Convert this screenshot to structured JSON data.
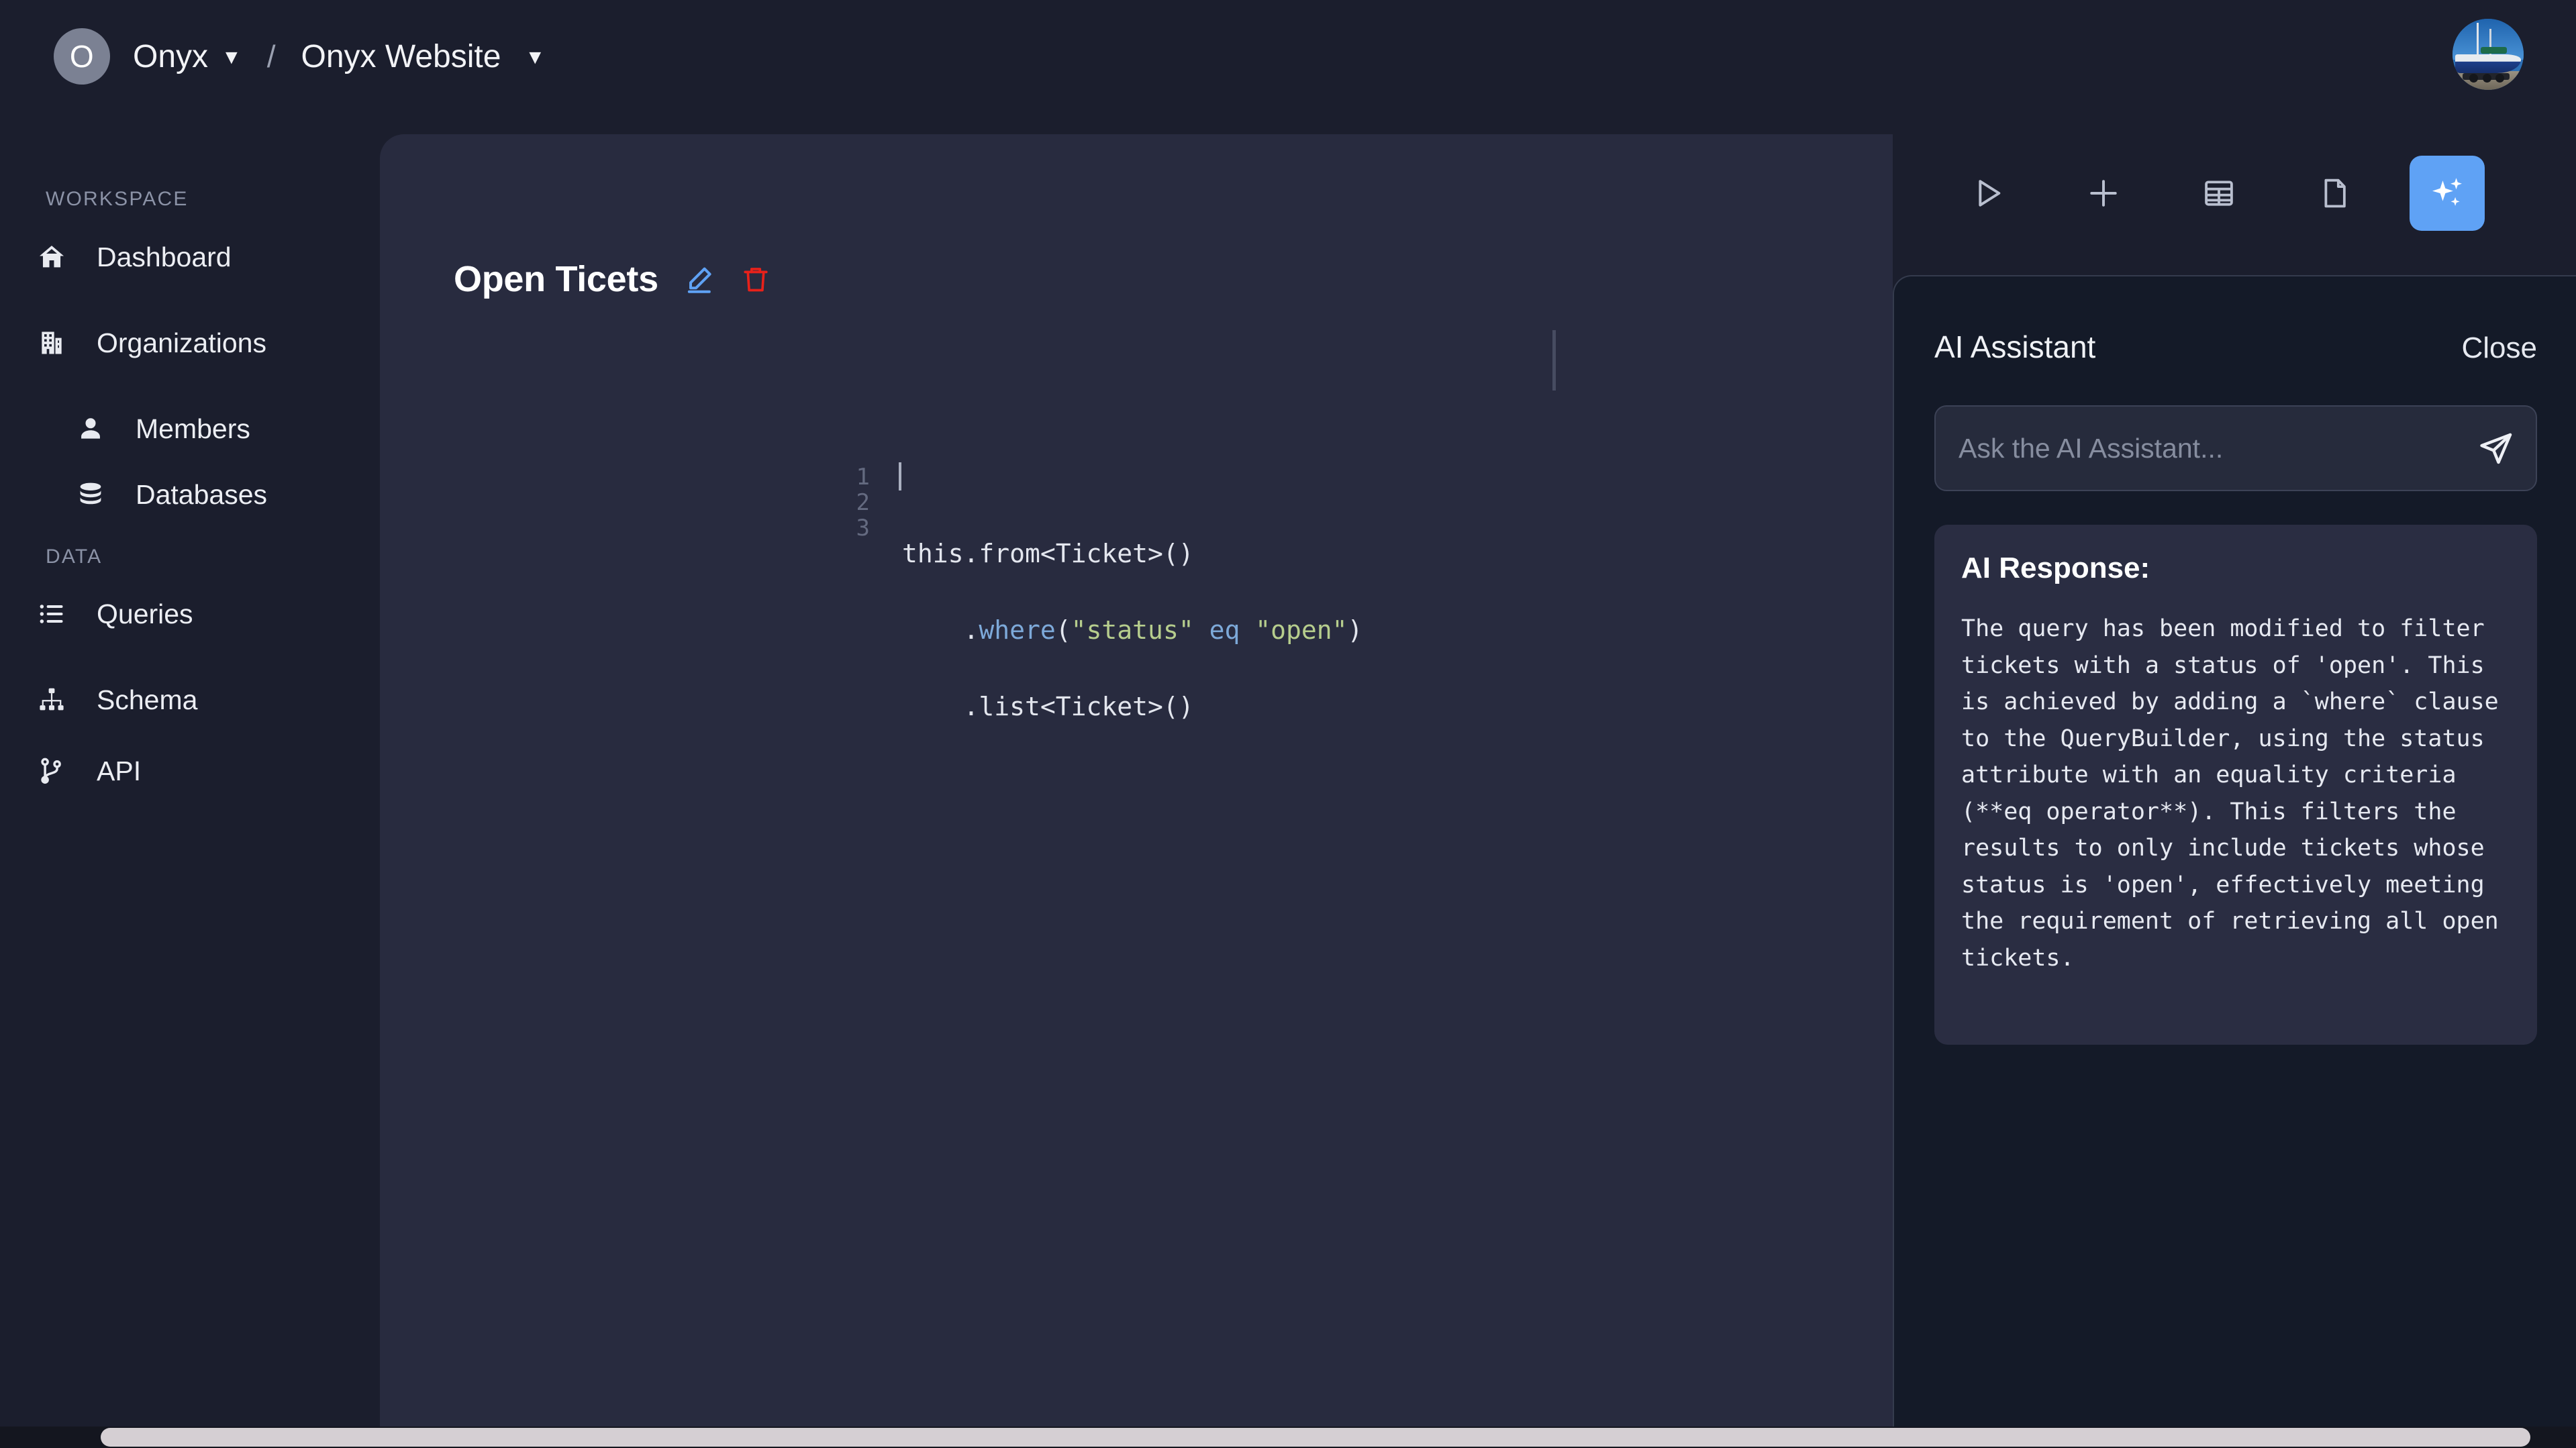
{
  "header": {
    "org_initial": "O",
    "org_name": "Onyx",
    "org_caret": "▼",
    "breadcrumb_separator": "/",
    "project_name": "Onyx Website",
    "project_caret": "▼",
    "user_avatar_icon": "sailboat-photo-avatar"
  },
  "sidebar": {
    "sections": [
      {
        "label": "WORKSPACE",
        "items": [
          {
            "label": "Dashboard",
            "icon": "home-icon",
            "level": 0
          },
          {
            "label": "Organizations",
            "icon": "building-icon",
            "level": 0
          },
          {
            "label": "Members",
            "icon": "user-icon",
            "level": 1
          },
          {
            "label": "Databases",
            "icon": "database-icon",
            "level": 1
          }
        ]
      },
      {
        "label": "DATA",
        "items": [
          {
            "label": "Queries",
            "icon": "list-icon",
            "level": 0
          },
          {
            "label": "Schema",
            "icon": "sitemap-icon",
            "level": 0
          },
          {
            "label": "API",
            "icon": "git-branch-icon",
            "level": 0
          }
        ]
      }
    ]
  },
  "toolbar": {
    "buttons": [
      {
        "name": "run-query-button",
        "icon": "play-icon",
        "active": false
      },
      {
        "name": "add-query-button",
        "icon": "plus-icon",
        "active": false
      },
      {
        "name": "table-view-button",
        "icon": "table-icon",
        "active": false
      },
      {
        "name": "document-view-button",
        "icon": "file-icon",
        "active": false
      },
      {
        "name": "ai-assistant-button",
        "icon": "sparkles-icon",
        "active": true
      }
    ],
    "active_accent_color": "#5fa2f5"
  },
  "editor": {
    "query_title": "Open Ticets",
    "edit_icon": "pencil-icon",
    "edit_icon_color": "#5fa2f5",
    "delete_icon": "trash-icon",
    "delete_icon_color": "#e8211a",
    "line_numbers": [
      "1",
      "2",
      "3"
    ],
    "code_lines": [
      [
        {
          "text": "this.from<Ticket>()",
          "type": "plain"
        }
      ],
      [
        {
          "text": "    .",
          "type": "plain"
        },
        {
          "text": "where",
          "type": "keyword"
        },
        {
          "text": "(",
          "type": "plain"
        },
        {
          "text": "\"status\"",
          "type": "string"
        },
        {
          "text": " ",
          "type": "plain"
        },
        {
          "text": "eq",
          "type": "keyword"
        },
        {
          "text": " ",
          "type": "plain"
        },
        {
          "text": "\"open\"",
          "type": "string"
        },
        {
          "text": ")",
          "type": "plain"
        }
      ],
      [
        {
          "text": "    .list<Ticket>()",
          "type": "plain"
        }
      ]
    ],
    "syntax_colors": {
      "plain": "#e3e6ee",
      "keyword": "#7da9d9",
      "string": "#b6cd8d",
      "line_number": "#646a80"
    }
  },
  "ai_panel": {
    "title": "AI Assistant",
    "close_label": "Close",
    "input_value": "",
    "input_placeholder": "Ask the AI Assistant...",
    "send_icon": "send-icon",
    "response_label": "AI Response:",
    "response_text": "The query has been modified to filter tickets with a status of 'open'. This is achieved by adding a `where` clause to the QueryBuilder, using the status attribute with an equality criteria (**eq operator**). This filters the results to only include tickets whose status is 'open', effectively meeting the requirement of retrieving all open tickets."
  },
  "colors": {
    "page_background": "#1b1e2d",
    "main_panel_background": "#282b3f",
    "ai_panel_background": "#141a28",
    "ai_card_background": "#2a2d42",
    "accent_blue": "#5fa2f5"
  }
}
